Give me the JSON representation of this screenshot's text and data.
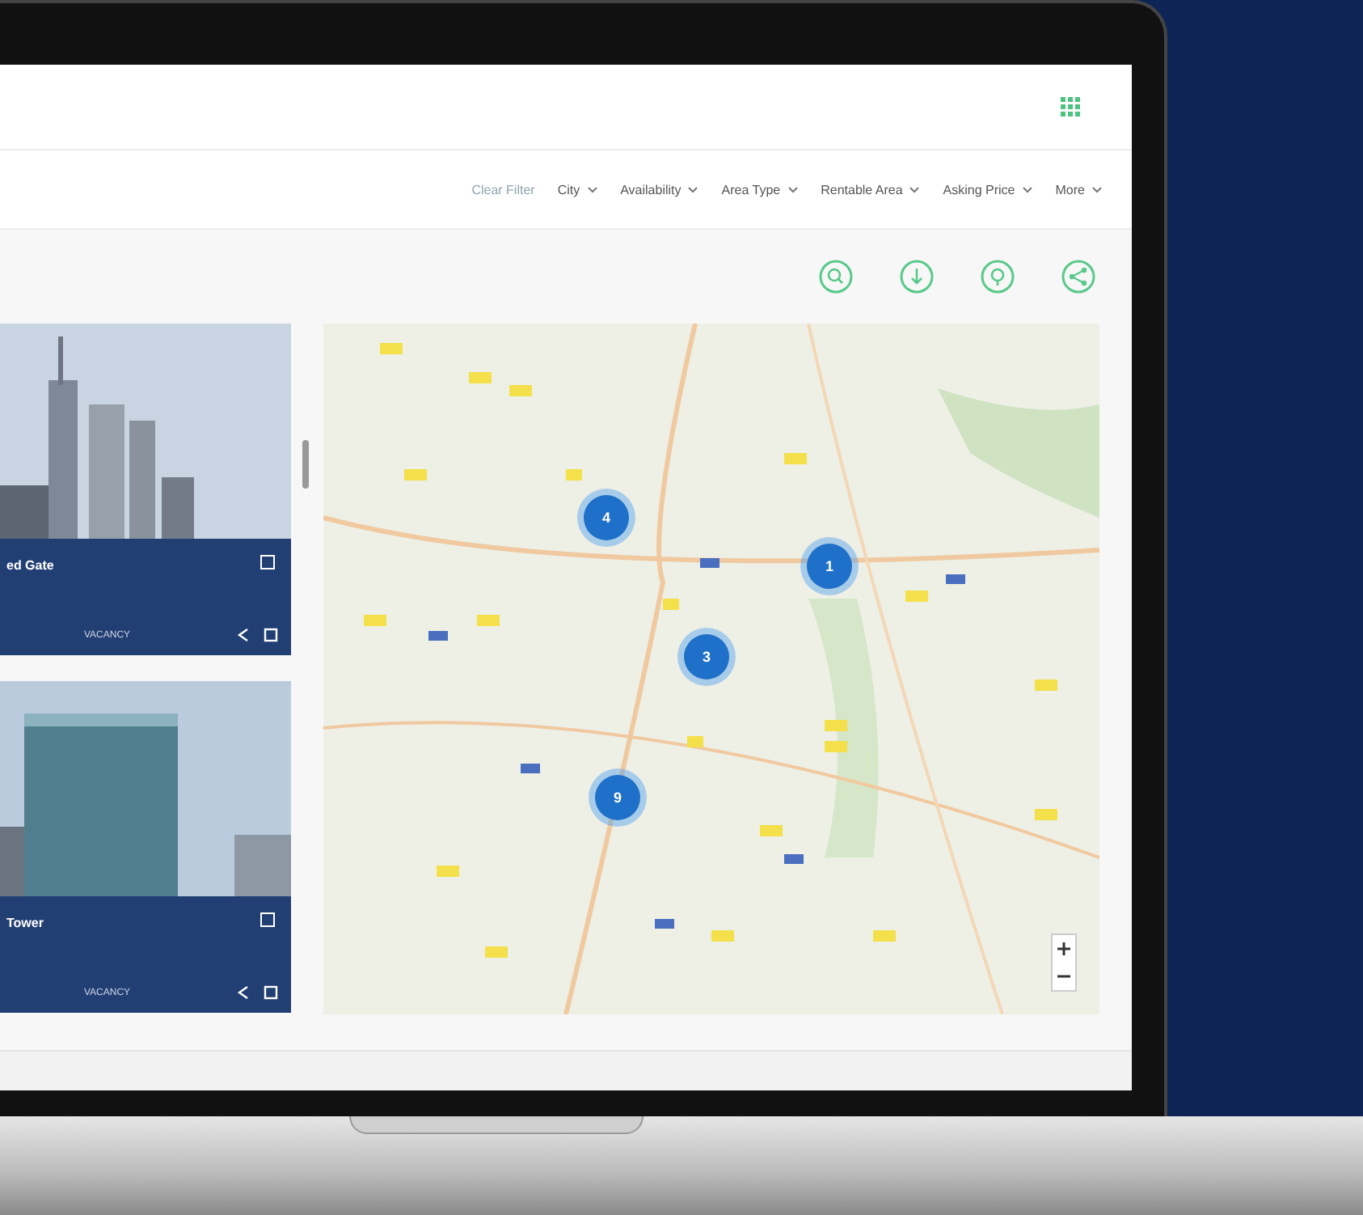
{
  "filters": [
    {
      "label": "Clear Filter",
      "disabled": true
    },
    {
      "label": "City",
      "disabled": false
    },
    {
      "label": "Availability",
      "disabled": false
    },
    {
      "label": "Area Type",
      "disabled": false
    },
    {
      "label": "Rentable Area",
      "disabled": false
    },
    {
      "label": "Asking Price",
      "disabled": false
    },
    {
      "label": "More",
      "disabled": false
    }
  ],
  "listings": [
    {
      "title": "ed Gate",
      "stat_label": "VACANCY",
      "checked": false
    },
    {
      "title": "Tower",
      "stat_label": "VACANCY",
      "checked": false
    }
  ],
  "map": {
    "clusters": [
      {
        "count": "4"
      },
      {
        "count": "1"
      },
      {
        "count": "3"
      },
      {
        "count": "9"
      }
    ]
  }
}
